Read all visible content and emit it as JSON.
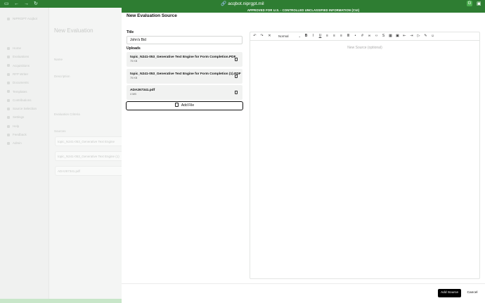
{
  "browser": {
    "url": "acqbot.niprgpt.mil"
  },
  "banner": {
    "text": "APPROVED FOR U.S. - CONTROLLED UNCLASSIFIED INFORMATION (CUI)"
  },
  "background": {
    "app_name": "NIPRGPT Acqbot",
    "page_title": "New Evaluation",
    "sidebar_items": [
      "Home",
      "Evaluations",
      "Acquisitions",
      "RFP Writer",
      "Documents",
      "Templates",
      "Contributions",
      "Source Selection",
      "Settings",
      "Help",
      "Feedback",
      "Admin"
    ],
    "fields": [
      "Name",
      "Description",
      "Evaluation Criteria",
      "Sources"
    ],
    "ghost_lines": [
      "topic_N241-053_Generative Text Engine",
      "topic_N241-053_Generative Text Engine (1)",
      "ADA267341.pdf"
    ]
  },
  "dialog": {
    "title": "New Evaluation Source",
    "title_label": "Title",
    "title_value": "John's Bid",
    "uploads_label": "Uploads",
    "files": [
      {
        "name": "topic_N241-053_Generative Text Engine for Form Completion.PDF",
        "size": "75 KB"
      },
      {
        "name": "topic_N241-053_Generative Text Engine for Form Completion (1).PDF",
        "size": "75 KB"
      },
      {
        "name": "ADA267341.pdf",
        "size": "4 MB"
      }
    ],
    "add_file_label": "Add File",
    "editor": {
      "format_value": "Normal",
      "placeholder": "New Source (optional)"
    },
    "add_source_label": "Add Source",
    "cancel_label": "Cancel"
  }
}
